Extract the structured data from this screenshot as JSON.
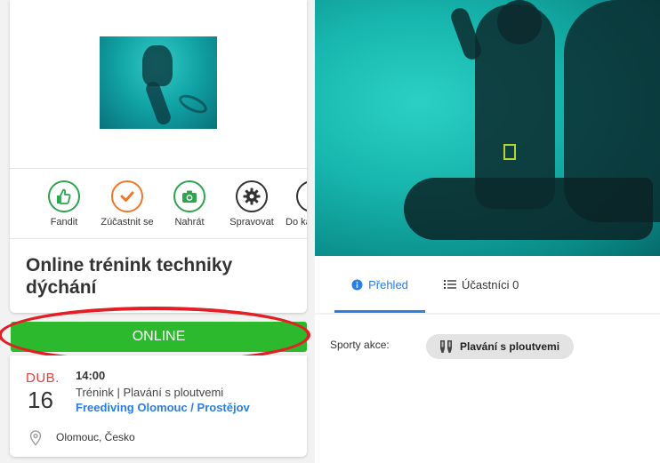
{
  "event": {
    "title": "Online trénink techniky dýchání",
    "status_button": "ONLINE",
    "date": {
      "month": "DUB.",
      "day": "16"
    },
    "time": "14:00",
    "type_line": "Trénink | Plavání s ploutvemi",
    "organizer": "Freediving Olomouc / Prostějov",
    "location": "Olomouc, Česko"
  },
  "actions": [
    {
      "label": "Fandit",
      "icon": "thumbs-up-icon",
      "color": "#2ea44f"
    },
    {
      "label": "Zúčastnit se",
      "icon": "check-icon",
      "color": "#f0762a"
    },
    {
      "label": "Nahrát",
      "icon": "camera-icon",
      "color": "#2ea44f"
    },
    {
      "label": "Spravovat",
      "icon": "gear-icon",
      "color": "#333333"
    },
    {
      "label": "Do ka",
      "icon": "calendar-icon",
      "color": "#333333"
    }
  ],
  "tabs": {
    "overview": "Přehled",
    "participants": "Účastníci 0"
  },
  "sports": {
    "label": "Sporty akce:",
    "chip": "Plavání s ploutvemi"
  },
  "colors": {
    "accent_blue": "#2a7de1",
    "online_green": "#2db92d",
    "month_red": "#e0403a",
    "highlight_red": "#e31e24"
  }
}
